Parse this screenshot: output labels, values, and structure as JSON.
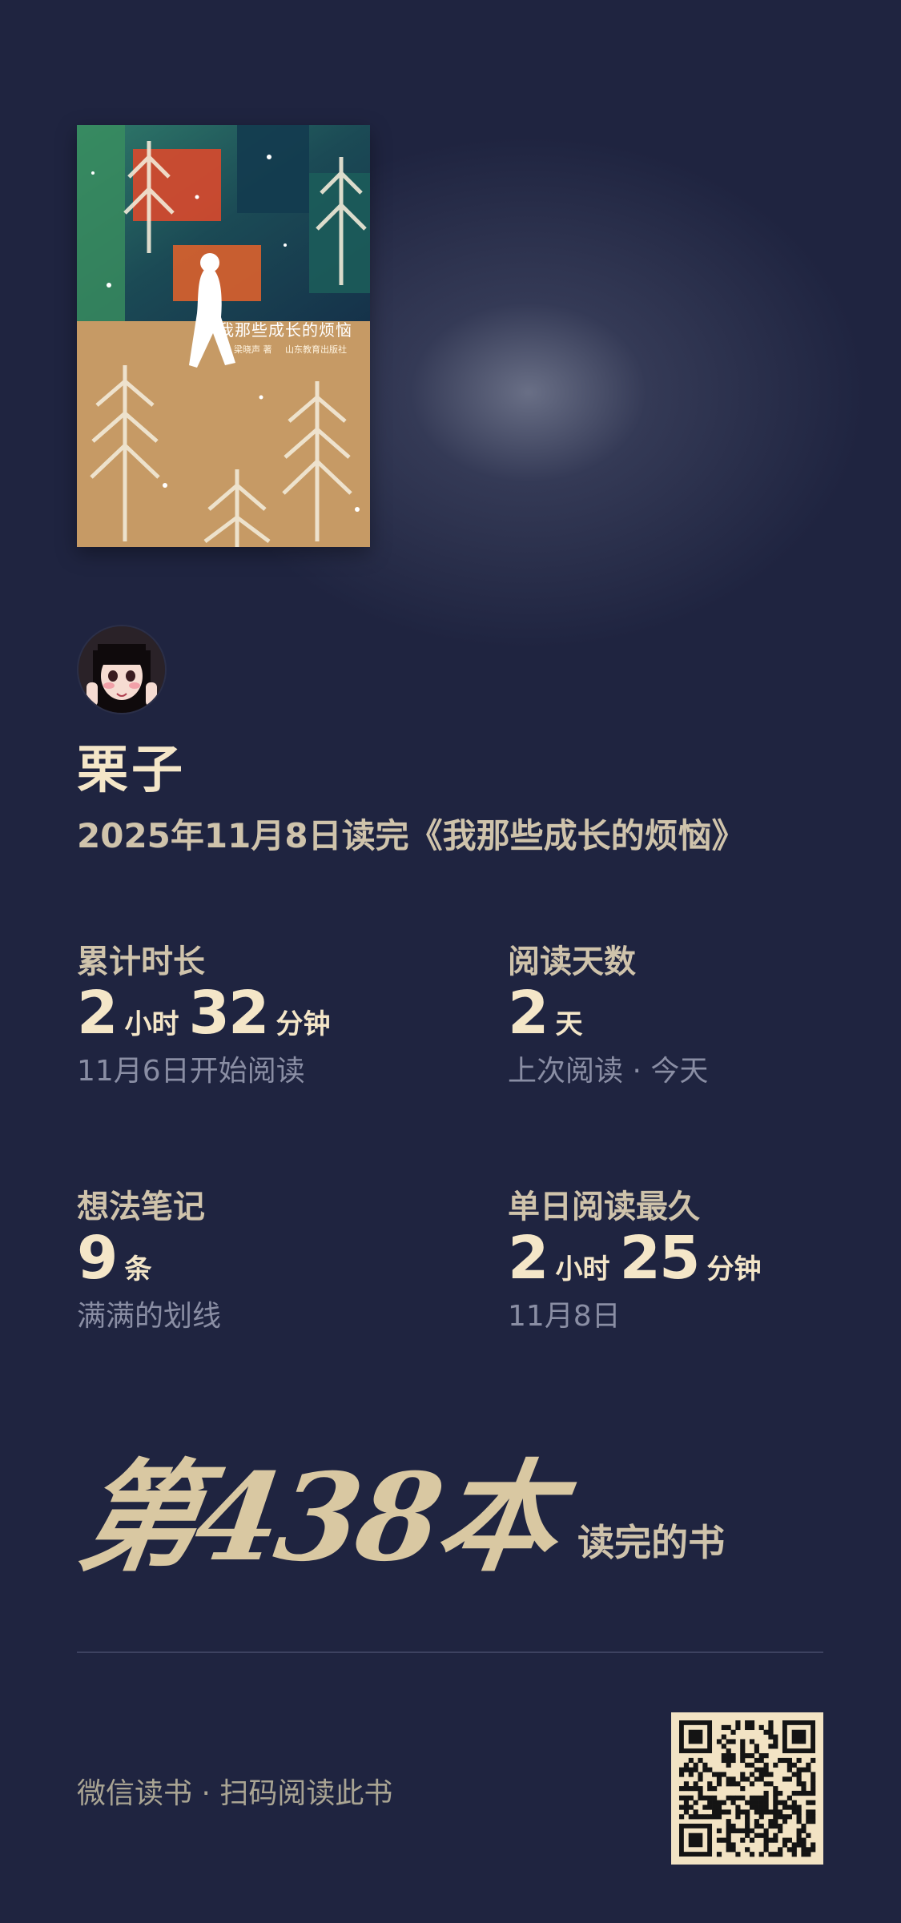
{
  "book": {
    "cover_title": "我那些成长的烦恼",
    "cover_author": "梁晓声 著",
    "cover_publisher": "山东教育出版社"
  },
  "user": {
    "name": "栗子",
    "finish_line": "2025年11月8日读完《我那些成长的烦恼》"
  },
  "stats": {
    "total_time": {
      "title": "累计时长",
      "hours": "2",
      "hours_unit": "小时",
      "minutes": "32",
      "minutes_unit": "分钟",
      "sub": "11月6日开始阅读"
    },
    "reading_days": {
      "title": "阅读天数",
      "value": "2",
      "unit": "天",
      "sub": "上次阅读 · 今天"
    },
    "notes": {
      "title": "想法笔记",
      "value": "9",
      "unit": "条",
      "sub": "满满的划线"
    },
    "longest_day": {
      "title": "单日阅读最久",
      "hours": "2",
      "hours_unit": "小时",
      "minutes": "25",
      "minutes_unit": "分钟",
      "sub": "11月8日"
    }
  },
  "rank": {
    "big": "第438本",
    "suffix": "读完的书"
  },
  "footer": {
    "text": "微信读书 · 扫码阅读此书"
  },
  "colors": {
    "background": "#1f2440",
    "accent_cream": "#f4e6c8",
    "label_beige": "#cfc3ab",
    "muted_gray": "#8a8ea4"
  }
}
